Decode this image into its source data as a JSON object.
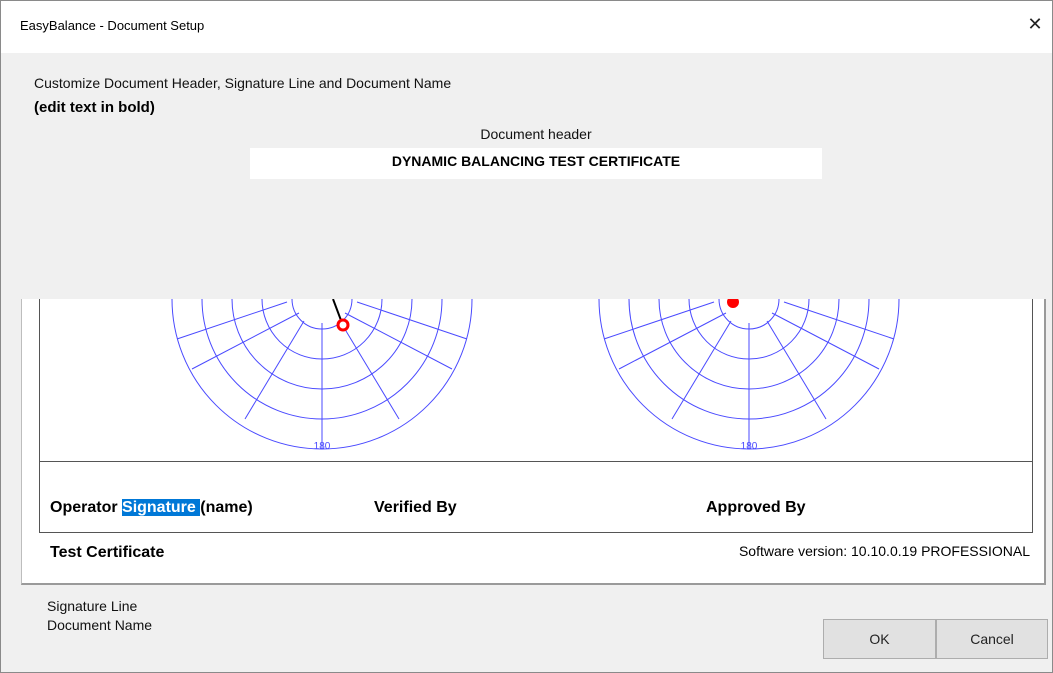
{
  "window": {
    "title": "EasyBalance - Document Setup",
    "close_glyph": "✕"
  },
  "instructions": {
    "line1": "Customize Document Header, Signature Line and Document Name",
    "line2": "(edit text in bold)"
  },
  "document_header": {
    "caption": "Document header",
    "value": "DYNAMIC BALANCING TEST CERTIFICATE"
  },
  "preview": {
    "polar_left_label": "180",
    "polar_right_label": "180",
    "signature": {
      "operator_prefix": "Operator ",
      "operator_selected": "Signature ",
      "operator_suffix": "(name)",
      "verified": "Verified By",
      "approved": "Approved By"
    },
    "document_name": "Test Certificate",
    "software_version": "Software version: 10.10.0.19 PROFESSIONAL",
    "colors": {
      "polar_lines": "#4a4aff",
      "marker": "#ff0000",
      "selection": "#0078d7"
    }
  },
  "labels": {
    "signature_line": "Signature Line",
    "document_name": "Document Name"
  },
  "buttons": {
    "ok": "OK",
    "cancel": "Cancel"
  },
  "icons": {
    "close": "close-icon"
  }
}
